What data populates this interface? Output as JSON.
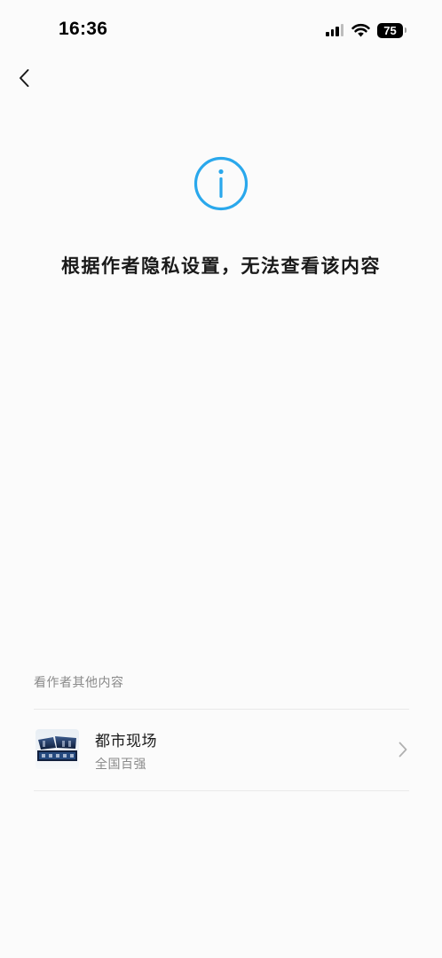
{
  "status_bar": {
    "time": "16:36",
    "battery": "75"
  },
  "nav": {
    "back_icon": "chevron-left-icon"
  },
  "notice": {
    "icon": "info-icon",
    "icon_color": "#2aa8ec",
    "message": "根据作者隐私设置，无法查看该内容"
  },
  "more_section": {
    "title": "看作者其他内容",
    "author": {
      "name": "都市现场",
      "subtitle": "全国百强",
      "chevron_icon": "chevron-right-icon"
    }
  }
}
